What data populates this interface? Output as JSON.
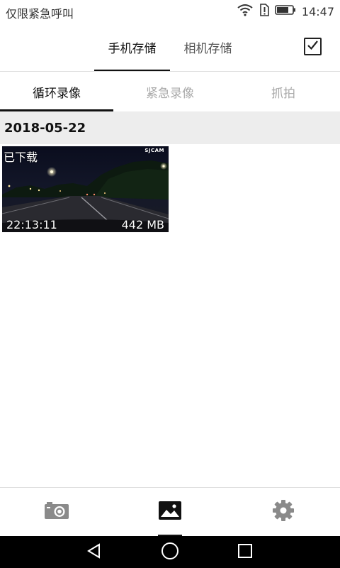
{
  "status_bar": {
    "carrier_text": "仅限紧急呼叫",
    "time": "14:47",
    "icons": [
      "wifi-icon",
      "sim-alert-icon",
      "battery-icon"
    ]
  },
  "top_tabs": {
    "items": [
      {
        "label": "手机存储",
        "active": true
      },
      {
        "label": "相机存储",
        "active": false
      }
    ],
    "select_icon": "checkbox-checked-icon"
  },
  "sub_tabs": {
    "items": [
      {
        "label": "循环录像",
        "active": true
      },
      {
        "label": "紧急录像",
        "active": false
      },
      {
        "label": "抓拍",
        "active": false
      }
    ]
  },
  "gallery": {
    "groups": [
      {
        "date": "2018-05-22",
        "videos": [
          {
            "badge": "已下载",
            "duration": "22:13:11",
            "size": "442 MB",
            "watermark": "SJCAM"
          }
        ]
      }
    ]
  },
  "bottom_nav": {
    "items": [
      {
        "icon": "camera-icon",
        "active": false
      },
      {
        "icon": "gallery-icon",
        "active": true
      },
      {
        "icon": "settings-gear-icon",
        "active": false
      }
    ]
  },
  "system_nav": {
    "items": [
      "back-icon",
      "home-icon",
      "recents-icon"
    ]
  },
  "colors": {
    "active_text": "#111111",
    "inactive_text": "#aaaaaa",
    "date_header_bg": "#ededed",
    "divider": "#dcdcdc"
  }
}
